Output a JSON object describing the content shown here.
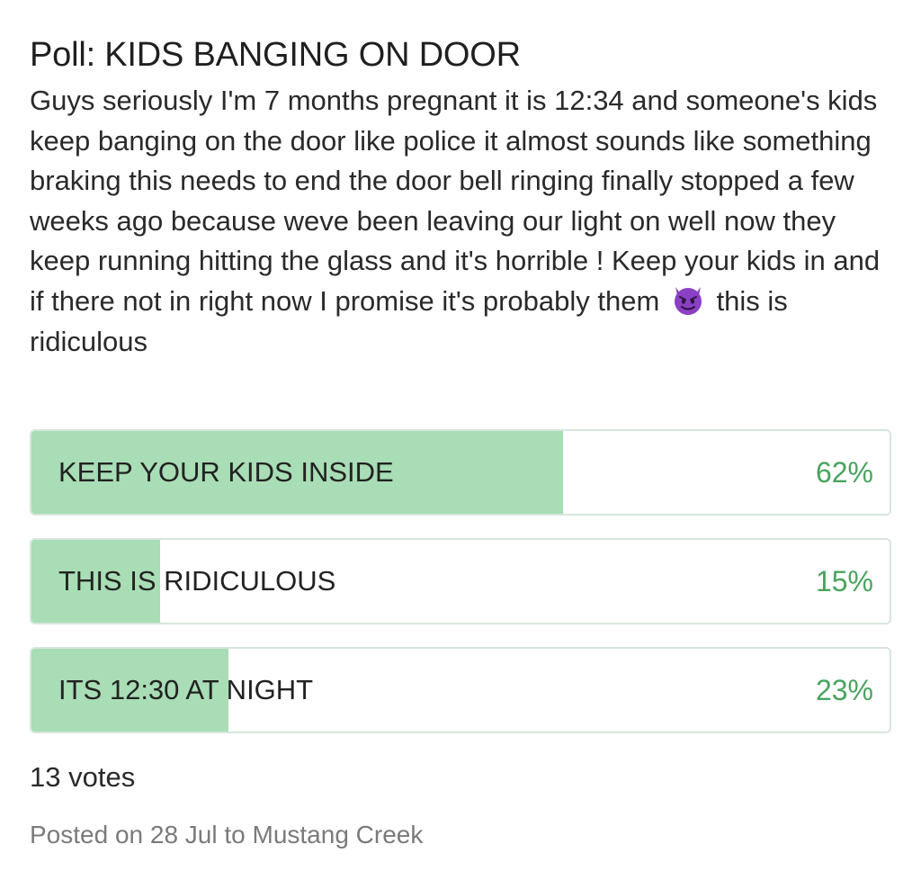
{
  "post": {
    "title": "Poll: KIDS BANGING ON DOOR",
    "body_before_emoji": "Guys seriously I'm 7 months pregnant it is 12:34 and someone's kids keep banging on the door like police it almost sounds like something braking this needs to end the door bell ringing finally stopped a few weeks ago because weve been leaving our light on well now they keep running hitting the glass and it's horrible ! Keep your kids in and if there not in right now I promise it's probably them",
    "emoji": "smiling-imp-emoji",
    "body_after_emoji": "this is ridiculous"
  },
  "poll": {
    "options": [
      {
        "label": "KEEP YOUR KIDS INSIDE",
        "percent_text": "62%",
        "fraction": 0.62
      },
      {
        "label": "THIS IS RIDICULOUS",
        "percent_text": "15%",
        "fraction": 0.15
      },
      {
        "label": "ITS 12:30 AT NIGHT",
        "percent_text": "23%",
        "fraction": 0.23
      }
    ],
    "votes": "13 votes"
  },
  "footer": {
    "posted": "Posted on 28 Jul to Mustang Creek"
  },
  "colors": {
    "fill": "#a8ddb5",
    "percent": "#49a45f",
    "border": "#d7e6dc",
    "emoji": "#8b3fc4"
  }
}
